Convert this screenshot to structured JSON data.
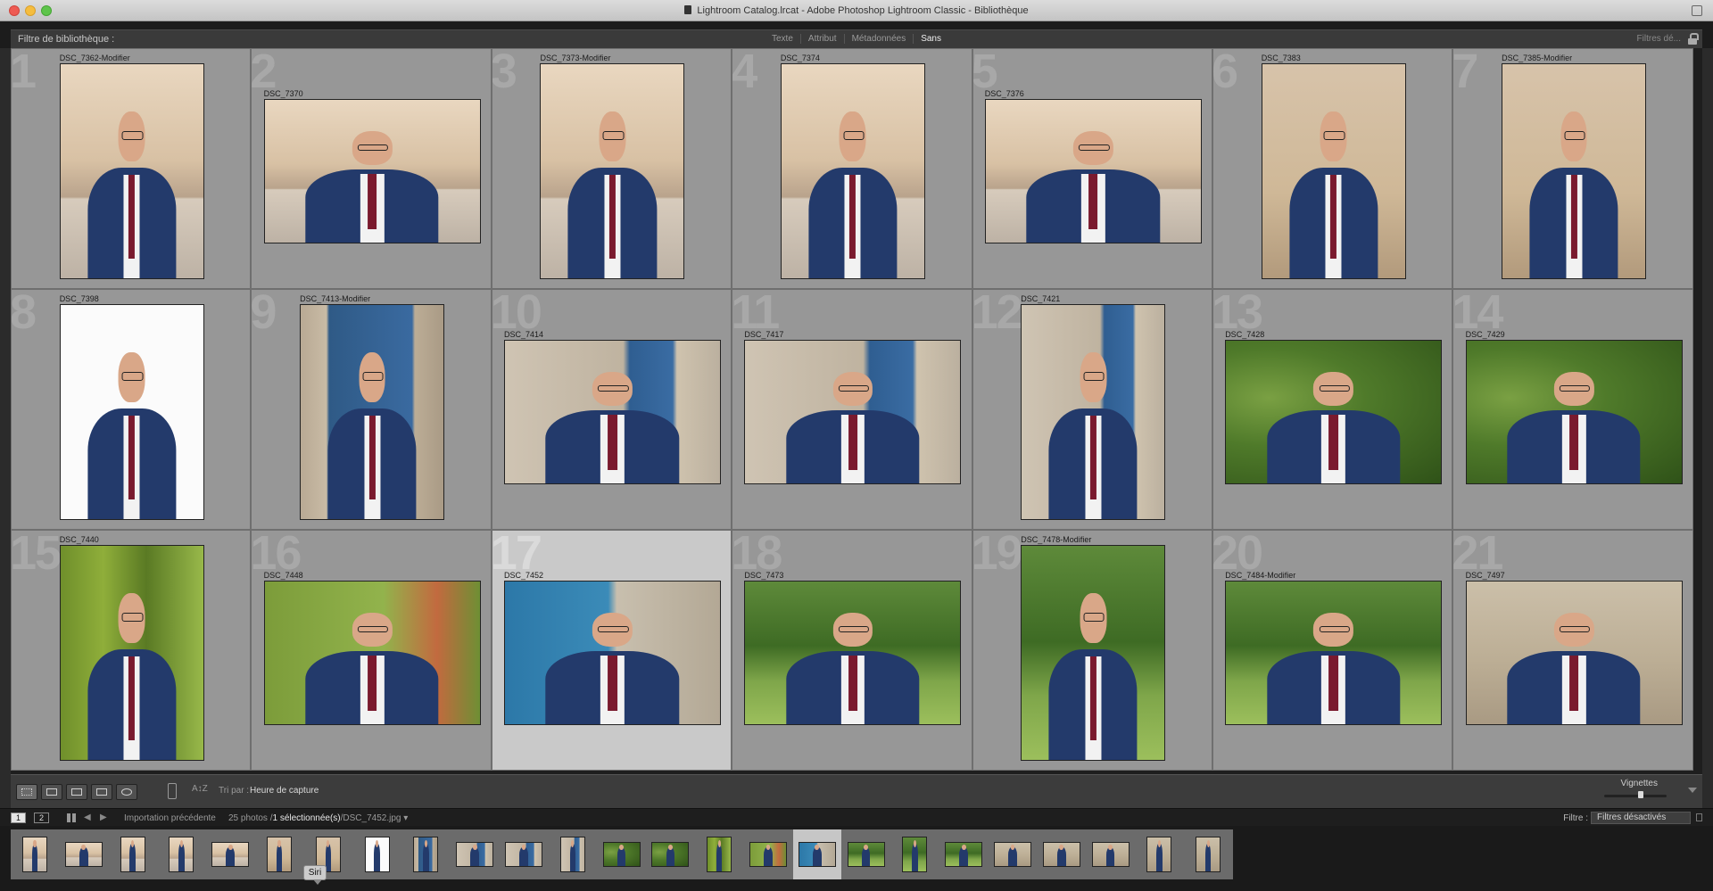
{
  "window": {
    "title": "Lightroom Catalog.lrcat - Adobe Photoshop Lightroom Classic - Bibliothèque"
  },
  "filter_bar": {
    "label": "Filtre de bibliothèque :",
    "tabs": [
      "Texte",
      "Attribut",
      "Métadonnées",
      "Sans"
    ],
    "active_tab": "Sans",
    "presets_label": "Filtres dé..."
  },
  "grid": {
    "cells": [
      {
        "num": "1",
        "name": "DSC_7362-Modifier",
        "orient": "portrait",
        "scene": "office"
      },
      {
        "num": "2",
        "name": "DSC_7370",
        "orient": "landscape",
        "scene": "office"
      },
      {
        "num": "3",
        "name": "DSC_7373-Modifier",
        "orient": "portrait",
        "scene": "office"
      },
      {
        "num": "4",
        "name": "DSC_7374",
        "orient": "portrait",
        "scene": "office"
      },
      {
        "num": "5",
        "name": "DSC_7376",
        "orient": "landscape",
        "scene": "office"
      },
      {
        "num": "6",
        "name": "DSC_7383",
        "orient": "portrait",
        "scene": "closeup"
      },
      {
        "num": "7",
        "name": "DSC_7385-Modifier",
        "orient": "portrait",
        "scene": "closeup"
      },
      {
        "num": "8",
        "name": "DSC_7398",
        "orient": "portrait",
        "scene": "studio"
      },
      {
        "num": "9",
        "name": "DSC_7413-Modifier",
        "orient": "portrait",
        "scene": "door"
      },
      {
        "num": "10",
        "name": "DSC_7414",
        "orient": "landscape",
        "scene": "doorwall"
      },
      {
        "num": "11",
        "name": "DSC_7417",
        "orient": "landscape",
        "scene": "doorwall"
      },
      {
        "num": "12",
        "name": "DSC_7421",
        "orient": "portrait",
        "scene": "doorwall"
      },
      {
        "num": "13",
        "name": "DSC_7428",
        "orient": "landscape",
        "scene": "garden"
      },
      {
        "num": "14",
        "name": "DSC_7429",
        "orient": "landscape",
        "scene": "garden"
      },
      {
        "num": "15",
        "name": "DSC_7440",
        "orient": "portrait",
        "scene": "ivy"
      },
      {
        "num": "16",
        "name": "DSC_7448",
        "orient": "landscape",
        "scene": "gate"
      },
      {
        "num": "17",
        "name": "DSC_7452",
        "orient": "landscape",
        "scene": "bluedoor",
        "selected": true
      },
      {
        "num": "18",
        "name": "DSC_7473",
        "orient": "landscape",
        "scene": "park"
      },
      {
        "num": "19",
        "name": "DSC_7478-Modifier",
        "orient": "portrait",
        "scene": "park"
      },
      {
        "num": "20",
        "name": "DSC_7484-Modifier",
        "orient": "landscape",
        "scene": "park"
      },
      {
        "num": "21",
        "name": "DSC_7497",
        "orient": "landscape",
        "scene": "window"
      }
    ]
  },
  "toolbar": {
    "sort_label": "Tri par :",
    "sort_value": "Heure de capture",
    "thumbnails_label": "Vignettes",
    "thumbnail_size": 0.6
  },
  "filmstrip": {
    "screen1": "1",
    "screen2": "2",
    "source": "Importation précédente",
    "count_prefix": "25 photos /",
    "count_selected": "1 sélectionnée(s)",
    "count_file": "/DSC_7452.jpg",
    "filter_label": "Filtre :",
    "filter_value": "Filtres désactivés",
    "selected_index": 16,
    "thumbs": [
      {
        "orient": "portrait",
        "scene": "office"
      },
      {
        "orient": "landscape",
        "scene": "office"
      },
      {
        "orient": "portrait",
        "scene": "office"
      },
      {
        "orient": "portrait",
        "scene": "office"
      },
      {
        "orient": "landscape",
        "scene": "office"
      },
      {
        "orient": "portrait",
        "scene": "closeup"
      },
      {
        "orient": "portrait",
        "scene": "closeup"
      },
      {
        "orient": "portrait",
        "scene": "studio"
      },
      {
        "orient": "portrait",
        "scene": "door"
      },
      {
        "orient": "landscape",
        "scene": "doorwall"
      },
      {
        "orient": "landscape",
        "scene": "doorwall"
      },
      {
        "orient": "portrait",
        "scene": "doorwall"
      },
      {
        "orient": "landscape",
        "scene": "garden"
      },
      {
        "orient": "landscape",
        "scene": "garden"
      },
      {
        "orient": "portrait",
        "scene": "ivy"
      },
      {
        "orient": "landscape",
        "scene": "gate"
      },
      {
        "orient": "landscape",
        "scene": "bluedoor"
      },
      {
        "orient": "landscape",
        "scene": "park"
      },
      {
        "orient": "portrait",
        "scene": "park"
      },
      {
        "orient": "landscape",
        "scene": "park"
      },
      {
        "orient": "landscape",
        "scene": "window"
      },
      {
        "orient": "landscape",
        "scene": "window"
      },
      {
        "orient": "landscape",
        "scene": "window"
      },
      {
        "orient": "portrait",
        "scene": "window"
      },
      {
        "orient": "portrait",
        "scene": "window"
      }
    ]
  },
  "tooltip": {
    "text": "Siri"
  }
}
